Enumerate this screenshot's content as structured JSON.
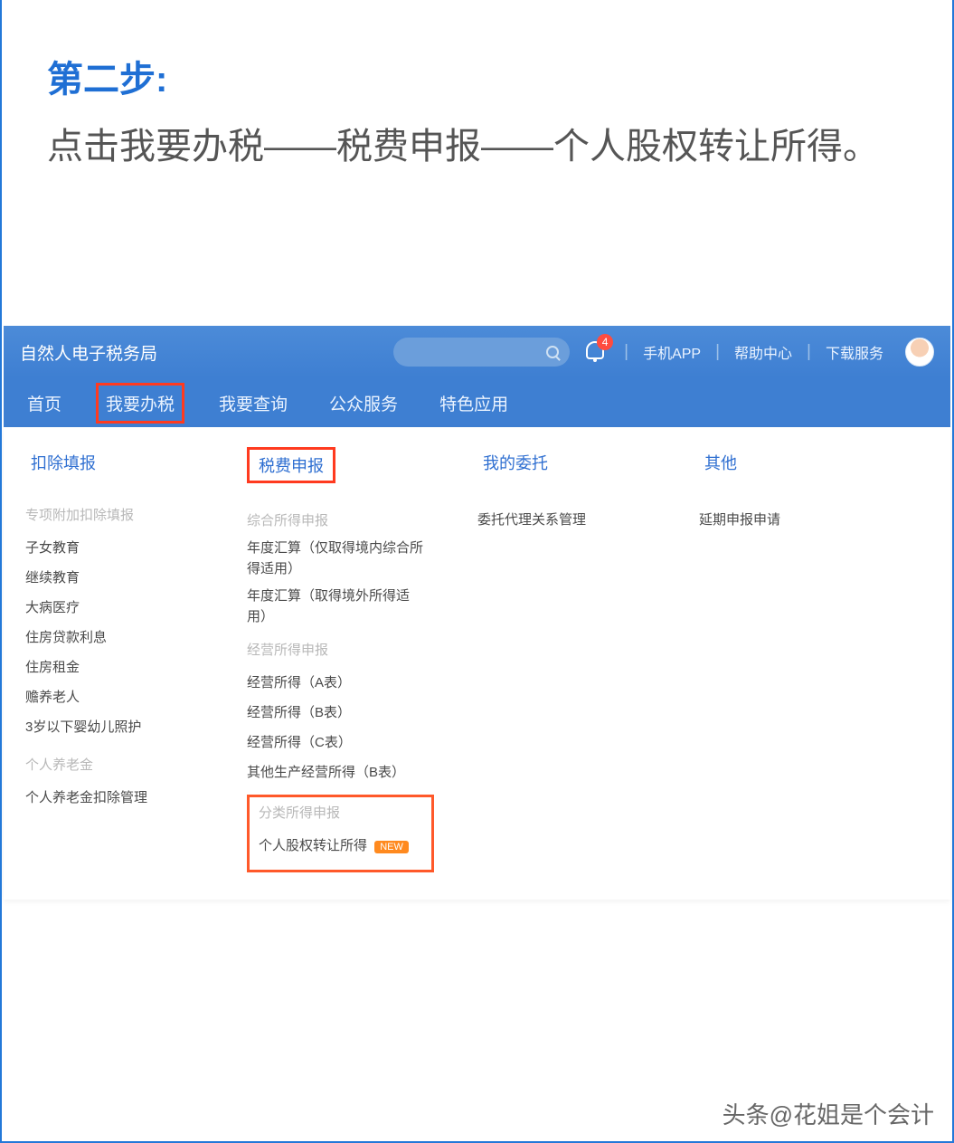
{
  "instruction": {
    "title": "第二步:",
    "body": "点击我要办税——税费申报——个人股权转让所得。"
  },
  "header": {
    "brand": "自然人电子税务局",
    "bell_count": "4",
    "links": {
      "app": "手机APP",
      "help": "帮助中心",
      "download": "下载服务"
    }
  },
  "nav": {
    "home": "首页",
    "tax": "我要办税",
    "query": "我要查询",
    "public": "公众服务",
    "feature": "特色应用"
  },
  "mega": {
    "col1": {
      "header": "扣除填报",
      "grp1_title": "专项附加扣除填报",
      "items1": {
        "a": "子女教育",
        "b": "继续教育",
        "c": "大病医疗",
        "d": "住房贷款利息",
        "e": "住房租金",
        "f": "赡养老人",
        "g": "3岁以下婴幼儿照护"
      },
      "grp2_title": "个人养老金",
      "items2": {
        "a": "个人养老金扣除管理"
      }
    },
    "col2": {
      "header": "税费申报",
      "grp1_title": "综合所得申报",
      "items1": {
        "a": "年度汇算（仅取得境内综合所得适用）",
        "b": "年度汇算（取得境外所得适用）"
      },
      "grp2_title": "经营所得申报",
      "items2": {
        "a": "经营所得（A表）",
        "b": "经营所得（B表）",
        "c": "经营所得（C表）",
        "d": "其他生产经营所得（B表）"
      },
      "grp3_title": "分类所得申报",
      "items3": {
        "a": "个人股权转让所得",
        "badge": "NEW"
      }
    },
    "col3": {
      "header": "我的委托",
      "items": {
        "a": "委托代理关系管理"
      }
    },
    "col4": {
      "header": "其他",
      "items": {
        "a": "延期申报申请"
      }
    }
  },
  "caption": "头条@花姐是个会计"
}
